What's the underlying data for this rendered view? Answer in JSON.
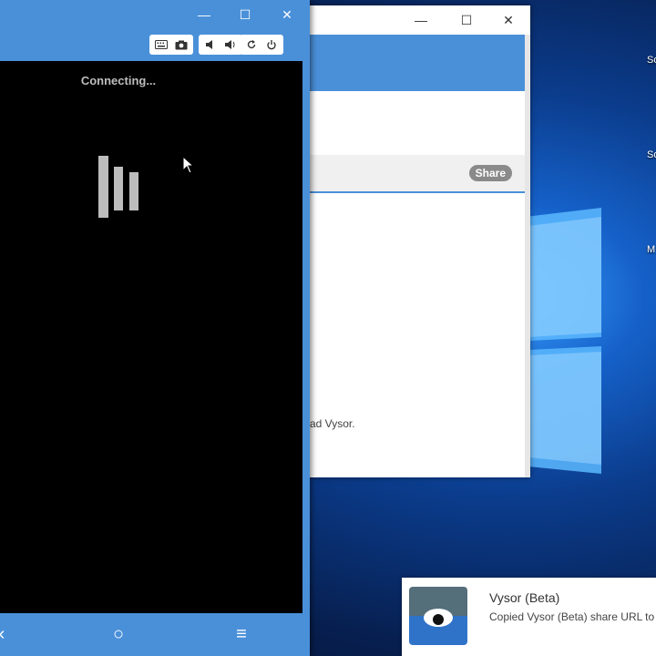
{
  "desktop": {
    "icon_labels": [
      "So",
      "So",
      "M"
    ]
  },
  "vysor_window": {
    "titlebar_controls": {
      "minimize": "—",
      "maximize": "☐",
      "close": "✕"
    },
    "toolbar": {
      "icons": [
        "keyboard-icon",
        "camera-icon",
        "volume-down-icon",
        "volume-up-icon",
        "rotate-icon",
        "power-icon"
      ]
    },
    "screen": {
      "status_text": "Connecting..."
    },
    "navbar": {
      "back": "‹",
      "home": "○",
      "menu": "≡"
    }
  },
  "app_window": {
    "titlebar_controls": {
      "minimize": "—",
      "maximize": "☐",
      "close": "✕"
    },
    "share_label": "Share",
    "body_text": "ad Vysor."
  },
  "notification": {
    "title": "Vysor (Beta)",
    "message": "Copied Vysor (Beta) share URL to c"
  },
  "colors": {
    "accent": "#4a90d9",
    "screen": "#000000",
    "desktop": "#0b3c8c"
  }
}
